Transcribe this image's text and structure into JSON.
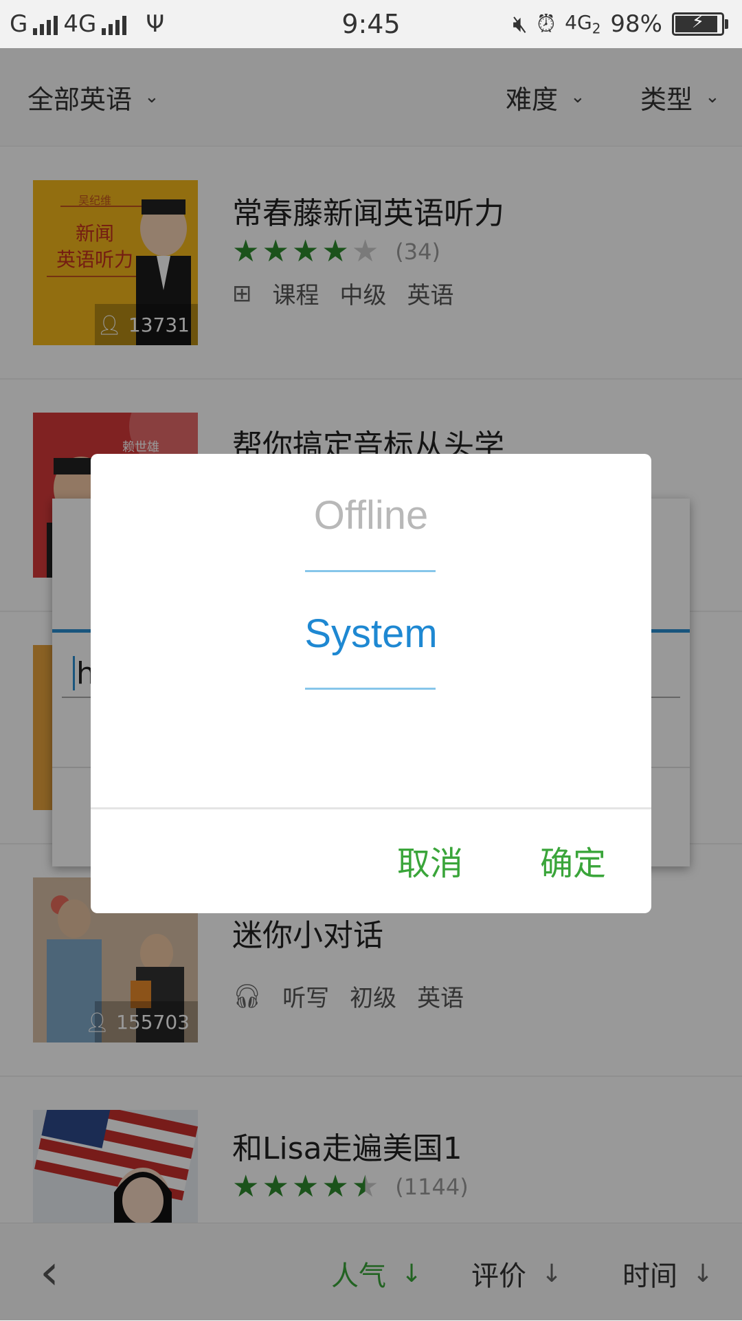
{
  "status_bar": {
    "carrier": "G",
    "network_1": "4G",
    "time": "9:45",
    "network_2": "4G",
    "sim_index": "2",
    "battery": "98%",
    "battery_level": 0.98
  },
  "filters": {
    "category": "全部英语",
    "difficulty": "难度",
    "type": "类型"
  },
  "courses": [
    {
      "title": "常春藤新闻英语听力",
      "stars_full": 4,
      "stars_half": 0,
      "rating": 4,
      "rating_count": "(34)",
      "tags": [
        "课程",
        "中级",
        "英语"
      ],
      "tag_icon": "hierarchy-icon",
      "thumb_text": [
        "吴纪维",
        "新闻",
        "英语听力"
      ],
      "learners": "13731",
      "thumb_color": "#f3b81c"
    },
    {
      "title": "帮你搞定音标从头学",
      "thumb_text": [
        "赖世雄"
      ],
      "thumb_color": "#d63a3a"
    },
    {
      "thumb_color": "#e6a23c"
    },
    {
      "title": "迷你小对话",
      "tags": [
        "听写",
        "初级",
        "英语"
      ],
      "tag_icon": "headphones-icon",
      "learners": "155703",
      "thumb_color": "#c9a98a"
    },
    {
      "title": "和Lisa走遍美国1",
      "stars_full": 4,
      "stars_half": 1,
      "rating": 4.5,
      "rating_count": "(1144)",
      "thumb_color": "#3b86c6"
    }
  ],
  "sort_bar": {
    "popularity": "人气",
    "review": "评价",
    "time": "时间",
    "active": "popularity"
  },
  "underlay": {
    "input_value": "h"
  },
  "dialog": {
    "options": [
      "Offline",
      "System"
    ],
    "selected": "System",
    "cancel": "取消",
    "confirm": "确定"
  },
  "colors": {
    "accent_green": "#3aa53a",
    "picker_blue": "#1e88d2",
    "star_green": "#2e8b2e"
  }
}
